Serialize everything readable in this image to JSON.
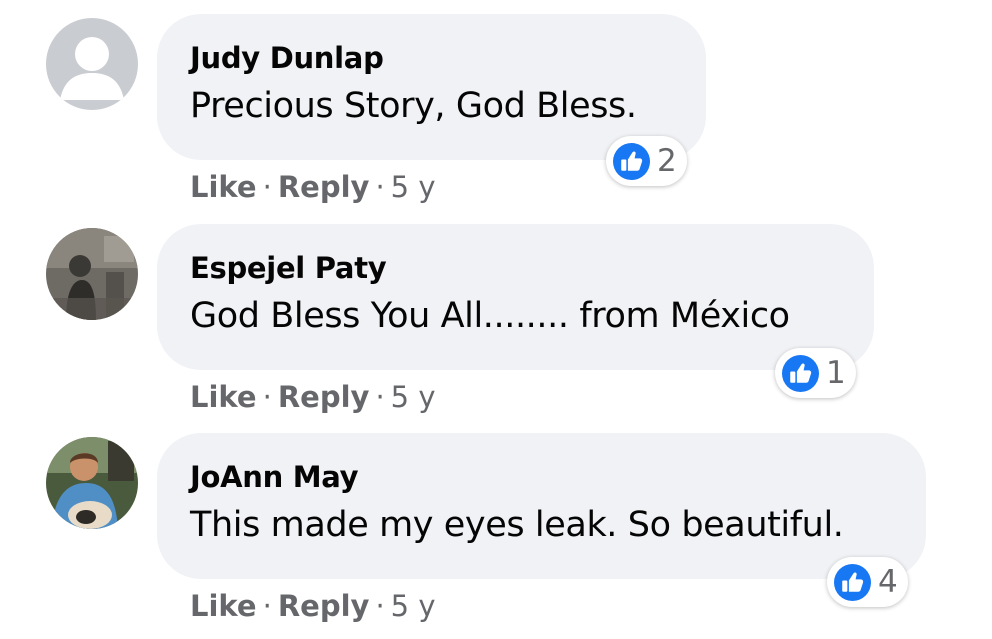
{
  "comments": [
    {
      "author": "Judy Dunlap",
      "text": "Precious Story, God Bless.",
      "reaction_count": "2",
      "actions": {
        "like": "Like",
        "reply": "Reply",
        "time": "5 y"
      }
    },
    {
      "author": "Espejel Paty",
      "text": "God Bless You All........ from México",
      "reaction_count": "1",
      "actions": {
        "like": "Like",
        "reply": "Reply",
        "time": "5 y"
      }
    },
    {
      "author": "JoAnn May",
      "text": "This made my eyes leak. So beautiful.",
      "reaction_count": "4",
      "actions": {
        "like": "Like",
        "reply": "Reply",
        "time": "5 y"
      }
    }
  ],
  "separator": "·",
  "colors": {
    "bubble": "#f0f2f5",
    "secondary_text": "#65676b",
    "primary_text": "#050505",
    "like_blue": "#1877f2"
  },
  "icons": {
    "reaction": "thumbs-up-icon",
    "default_avatar": "default-user-avatar-icon"
  }
}
